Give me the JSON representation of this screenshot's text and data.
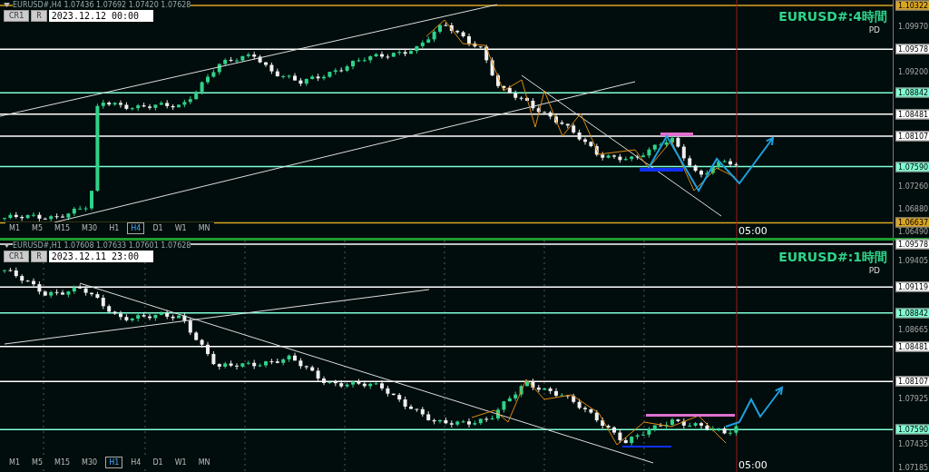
{
  "panels": [
    {
      "header": "EURUSD#,H4 1.07436 1.07692 1.07420 1.07628",
      "buttons": [
        "CR1",
        "R"
      ],
      "datetime": "2023.12.12 00:00",
      "title": "EURUSD#:4時間",
      "subtitle": "PD",
      "time_label": "05:00",
      "ticks": [
        "1.09970",
        "1.09200",
        "1.07260",
        "1.06880",
        "1.06490"
      ],
      "levels": [
        {
          "price": "1.10322",
          "color": "#daa520"
        },
        {
          "price": "1.09578",
          "color": "#ffffff"
        },
        {
          "price": "1.08842",
          "color": "#7fffd4"
        },
        {
          "price": "1.08481",
          "color": "#ffffff"
        },
        {
          "price": "1.08107",
          "color": "#ffffff"
        },
        {
          "price": "1.07590",
          "color": "#7fffd4"
        },
        {
          "price": "1.06637",
          "color": "#daa520"
        }
      ],
      "timeframes": [
        {
          "label": "M1",
          "selected": false
        },
        {
          "label": "M5",
          "selected": false
        },
        {
          "label": "M15",
          "selected": false
        },
        {
          "label": "M30",
          "selected": false
        },
        {
          "label": "H1",
          "selected": false
        },
        {
          "label": "H4",
          "selected": true
        },
        {
          "label": "D1",
          "selected": false
        },
        {
          "label": "W1",
          "selected": false
        },
        {
          "label": "MN",
          "selected": false
        }
      ]
    },
    {
      "header": "EURUSD#,H1 1.07608 1.07633 1.07601 1.07628",
      "buttons": [
        "CR1",
        "R"
      ],
      "datetime": "2023.12.11 23:00",
      "title": "EURUSD#:1時間",
      "subtitle": "PD",
      "time_label": "05:00",
      "ticks": [
        "1.09405",
        "1.08665",
        "1.07925",
        "1.07435",
        "1.07185"
      ],
      "levels": [
        {
          "price": "1.09578",
          "color": "#ffffff"
        },
        {
          "price": "1.09119",
          "color": "#ffffff"
        },
        {
          "price": "1.08842",
          "color": "#7fffd4"
        },
        {
          "price": "1.08481",
          "color": "#ffffff"
        },
        {
          "price": "1.08107",
          "color": "#ffffff"
        },
        {
          "price": "1.07590",
          "color": "#7fffd4"
        }
      ],
      "timeframes": [
        {
          "label": "M1",
          "selected": false
        },
        {
          "label": "M5",
          "selected": false
        },
        {
          "label": "M15",
          "selected": false
        },
        {
          "label": "M30",
          "selected": false
        },
        {
          "label": "H1",
          "selected": true
        },
        {
          "label": "H4",
          "selected": false
        },
        {
          "label": "D1",
          "selected": false
        },
        {
          "label": "W1",
          "selected": false
        },
        {
          "label": "MN",
          "selected": false
        }
      ]
    }
  ]
}
